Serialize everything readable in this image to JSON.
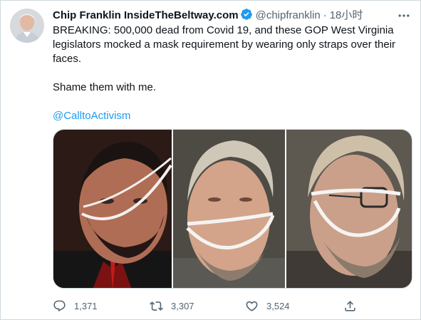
{
  "tweet": {
    "author_name": "Chip Franklin InsideTheBeltway.com",
    "handle": "@chipfranklin",
    "separator": "·",
    "time": "18小时",
    "text_line1": "BREAKING: 500,000 dead from Covid 19, and these GOP West Virginia legislators mocked a mask requirement by wearing only straps over their faces.",
    "text_line2": "Shame them with me.",
    "mention": "@CalltoActivism"
  },
  "actions": {
    "replies": "1,371",
    "retweets": "3,307",
    "likes": "3,524"
  },
  "icons": [
    "avatar",
    "verified-badge-icon",
    "more-options-icon",
    "reply-icon",
    "retweet-icon",
    "like-icon",
    "share-icon"
  ],
  "colors": {
    "accent": "#1d9bf0",
    "text": "#0f1419",
    "muted": "#536471",
    "border": "#cfd9de"
  }
}
